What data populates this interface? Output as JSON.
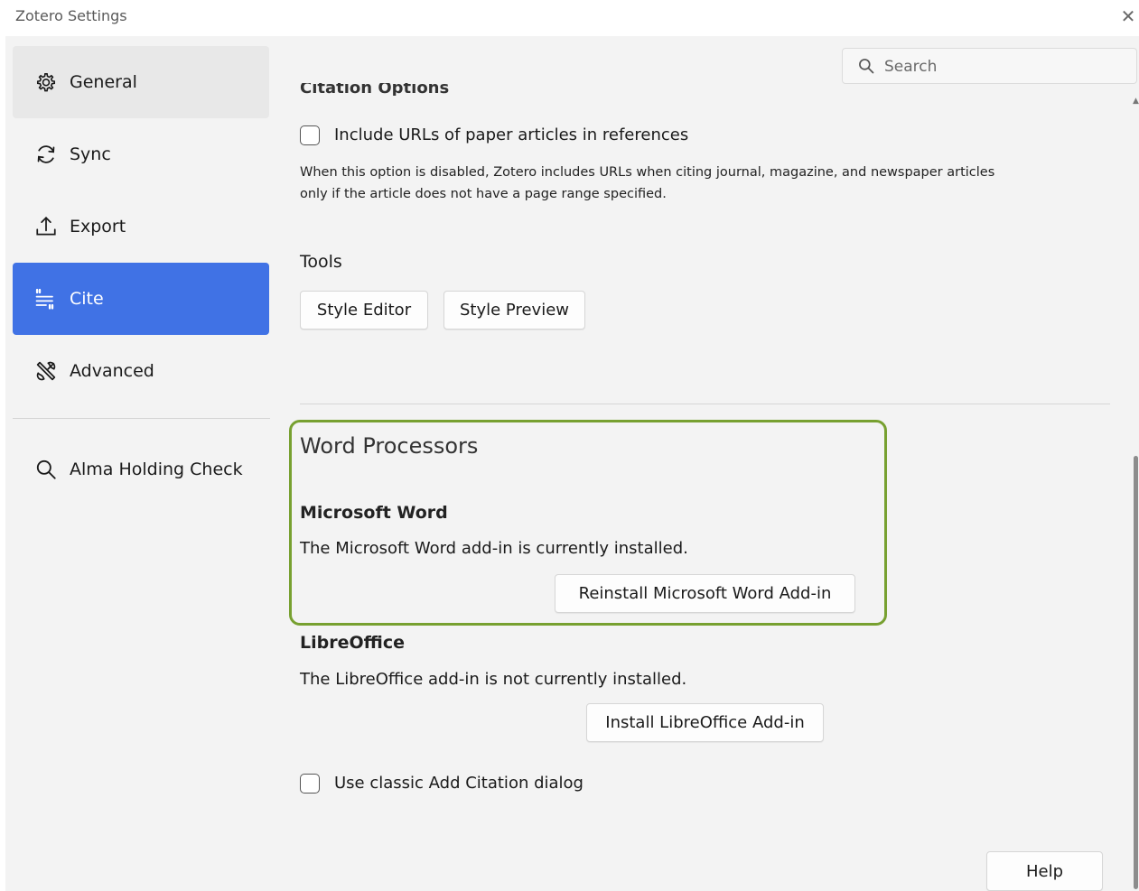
{
  "window": {
    "title": "Zotero Settings",
    "close_symbol": "✕"
  },
  "sidebar": {
    "items": [
      {
        "label": "General",
        "icon": "gear-icon"
      },
      {
        "label": "Sync",
        "icon": "sync-icon"
      },
      {
        "label": "Export",
        "icon": "export-icon"
      },
      {
        "label": "Cite",
        "icon": "cite-icon",
        "active": true
      },
      {
        "label": "Advanced",
        "icon": "tools-icon"
      }
    ],
    "plugin_items": [
      {
        "label": "Alma Holding Check",
        "icon": "search-icon"
      }
    ]
  },
  "search": {
    "placeholder": "Search",
    "value": ""
  },
  "citation_options": {
    "heading": "Citation Options",
    "include_urls_label": "Include URLs of paper articles in references",
    "include_urls_checked": false,
    "description_line1": "When this option is disabled, Zotero includes URLs when citing journal, magazine, and newspaper articles",
    "description_line2": "only if the article does not have a page range specified."
  },
  "tools": {
    "heading": "Tools",
    "style_editor_label": "Style Editor",
    "style_preview_label": "Style Preview"
  },
  "word_processors": {
    "heading": "Word Processors",
    "word": {
      "heading": "Microsoft Word",
      "status": "The Microsoft Word add-in is currently installed.",
      "button_label": "Reinstall Microsoft Word Add-in"
    },
    "libreoffice": {
      "heading": "LibreOffice",
      "status": "The LibreOffice add-in is not currently installed.",
      "button_label": "Install LibreOffice Add-in"
    },
    "classic_dialog_label": "Use classic Add Citation dialog",
    "classic_dialog_checked": false
  },
  "footer": {
    "help_label": "Help"
  },
  "colors": {
    "accent": "#4072e5",
    "highlight_border": "#77a030",
    "background": "#f3f3f3"
  }
}
